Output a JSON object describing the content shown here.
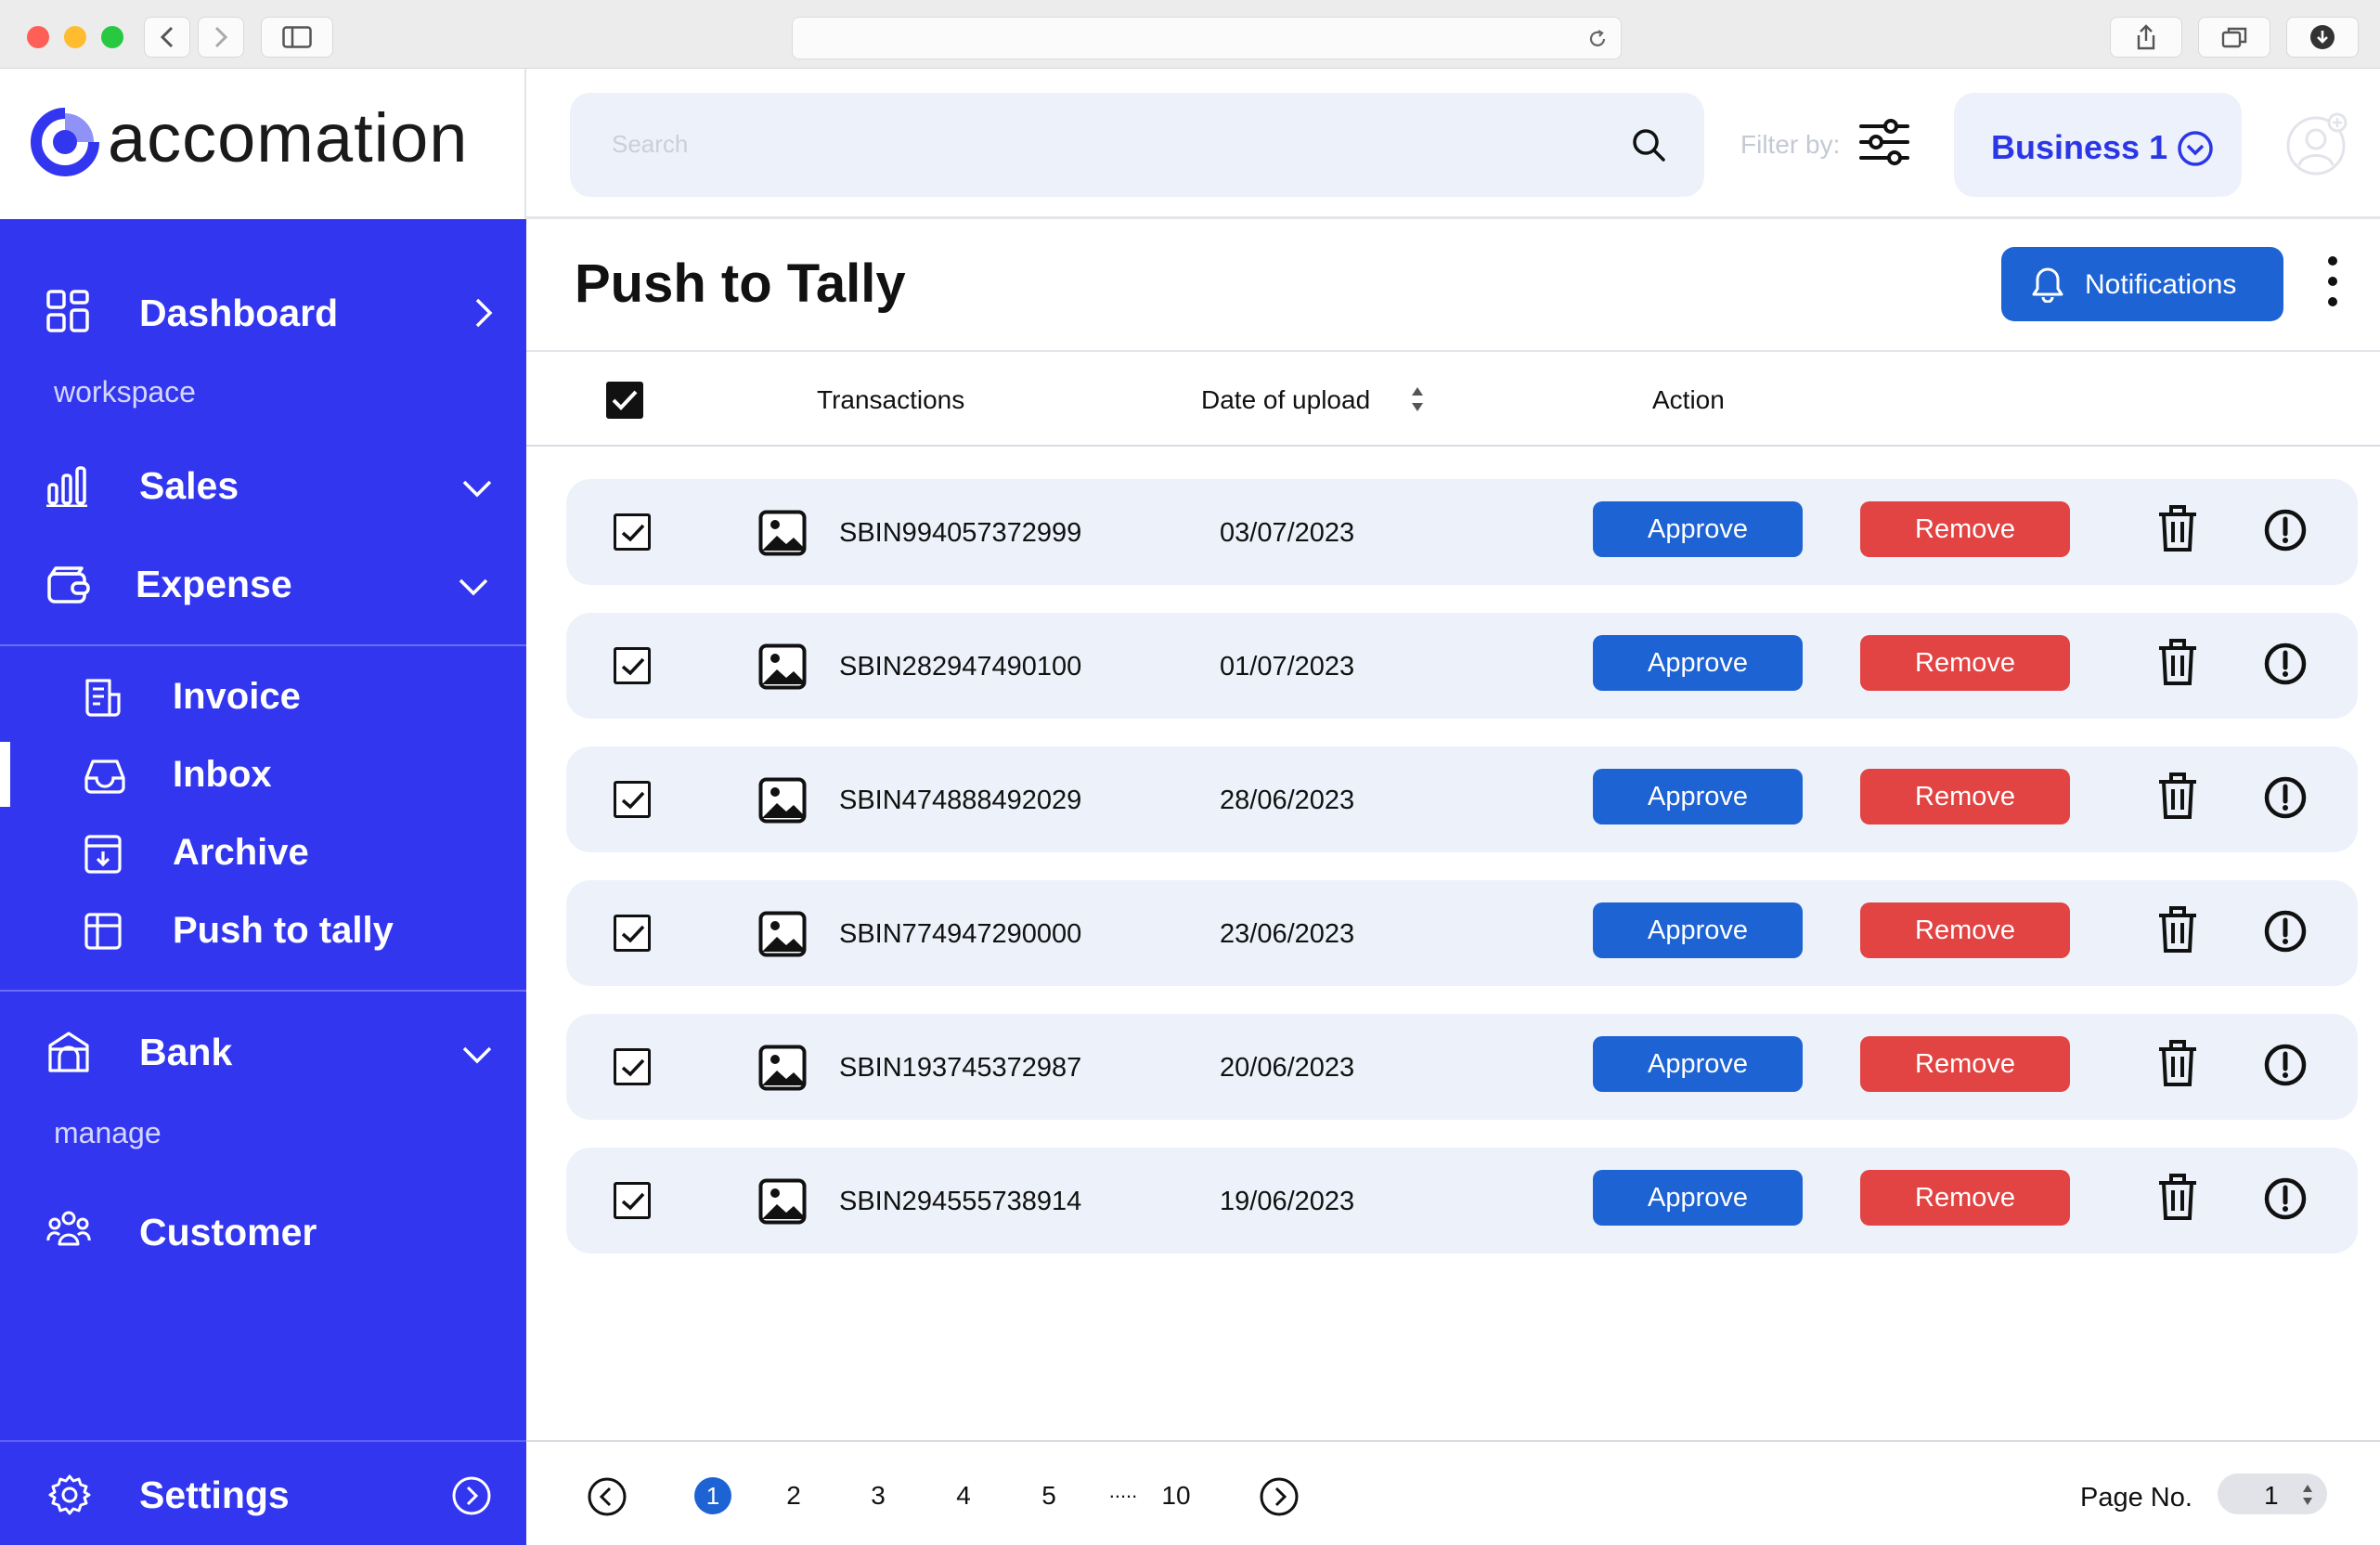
{
  "brand": {
    "name": "accomation",
    "color": "#3236ef"
  },
  "header": {
    "search_placeholder": "Search",
    "filter_label": "Filter by:",
    "business_selector": "Business 1"
  },
  "sidebar": {
    "dashboard": "Dashboard",
    "workspace_label": "workspace",
    "sales": "Sales",
    "expense": "Expense",
    "expense_items": [
      {
        "label": "Invoice",
        "icon": "invoice-icon"
      },
      {
        "label": "Inbox",
        "icon": "inbox-icon",
        "active": true
      },
      {
        "label": "Archive",
        "icon": "archive-icon"
      },
      {
        "label": "Push to tally",
        "icon": "table-icon"
      }
    ],
    "bank": "Bank",
    "manage_label": "manage",
    "customer": "Customer",
    "settings": "Settings"
  },
  "main": {
    "title": "Push to Tally",
    "notifications_label": "Notifications",
    "columns": {
      "transactions": "Transactions",
      "date": "Date of upload",
      "action": "Action"
    },
    "approve_label": "Approve",
    "remove_label": "Remove",
    "rows": [
      {
        "id": "SBIN994057372999",
        "date": "03/07/2023",
        "checked": true
      },
      {
        "id": "SBIN282947490100",
        "date": "01/07/2023",
        "checked": true
      },
      {
        "id": "SBIN474888492029",
        "date": "28/06/2023",
        "checked": true
      },
      {
        "id": "SBIN774947290000",
        "date": "23/06/2023",
        "checked": true
      },
      {
        "id": "SBIN193745372987",
        "date": "20/06/2023",
        "checked": true
      },
      {
        "id": "SBIN294555738914",
        "date": "19/06/2023",
        "checked": true
      }
    ]
  },
  "pagination": {
    "pages": [
      "1",
      "2",
      "3",
      "4",
      "5",
      ".....",
      "10"
    ],
    "current": "1",
    "page_no_label": "Page No.",
    "page_no_value": "1"
  },
  "colors": {
    "sidebar": "#3236ef",
    "primary_button": "#1d63d3",
    "danger_button": "#e24343",
    "row_background": "#edf2fa"
  }
}
